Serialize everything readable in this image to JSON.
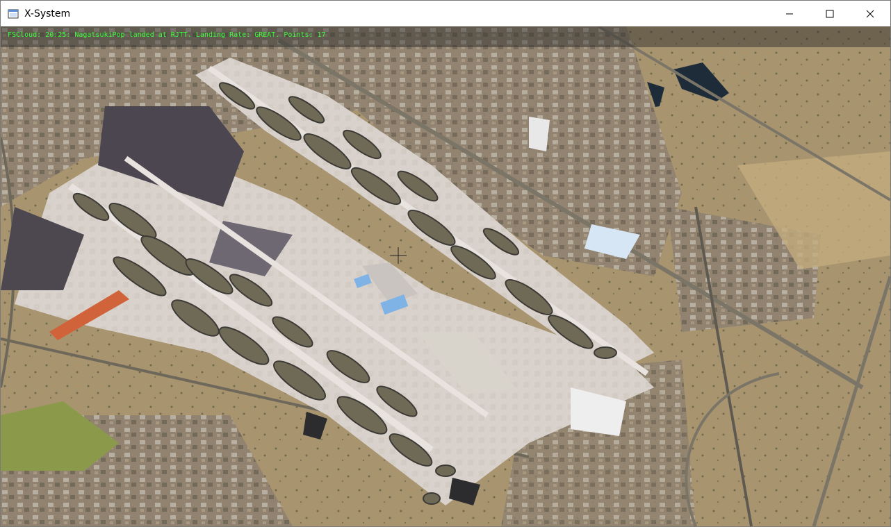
{
  "window": {
    "title": "X-System"
  },
  "notification": {
    "text": "FSCloud: 20:25: NagatsukiPop landed at RJTT. Landing Rate: GREAT. Points: 17"
  },
  "icons": {
    "app": "window-app-icon",
    "minimize": "minimize-icon",
    "maximize": "maximize-icon",
    "close": "close-icon",
    "crosshair": "crosshair-icon"
  }
}
